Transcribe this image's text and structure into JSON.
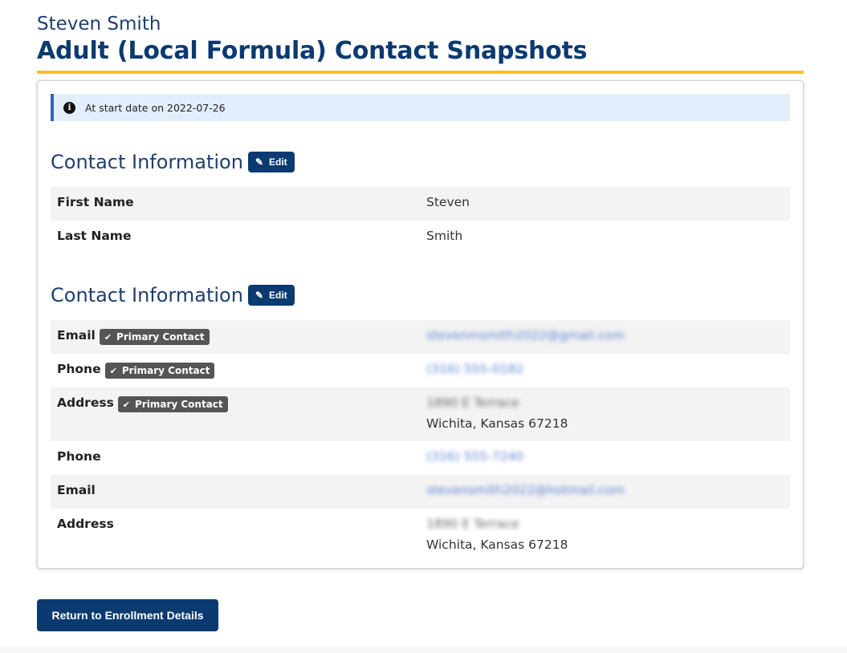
{
  "header": {
    "person_name": "Steven Smith",
    "page_title": "Adult (Local Formula) Contact Snapshots"
  },
  "alert": {
    "icon": "info-icon",
    "text": "At start date on 2022-07-26"
  },
  "sections": [
    {
      "title": "Contact Information",
      "edit_label": "Edit",
      "rows": [
        {
          "label": "First Name",
          "value": "Steven"
        },
        {
          "label": "Last Name",
          "value": "Smith"
        }
      ]
    },
    {
      "title": "Contact Information",
      "edit_label": "Edit",
      "rows": [
        {
          "label": "Email",
          "badge": "Primary Contact",
          "value": "stevenmsmith2022@gmail.com"
        },
        {
          "label": "Phone",
          "badge": "Primary Contact",
          "value": "(316) 555-0182"
        },
        {
          "label": "Address",
          "badge": "Primary Contact",
          "value_line1": "1890 E Terrace",
          "value_line2": "Wichita, Kansas 67218"
        },
        {
          "label": "Phone",
          "value": "(316) 555-7240"
        },
        {
          "label": "Email",
          "value": "stevensmith2022@hotmail.com"
        },
        {
          "label": "Address",
          "value_line1": "1890 E Terrace",
          "value_line2": "Wichita, Kansas 67218"
        }
      ]
    }
  ],
  "footer": {
    "return_label": "Return to Enrollment Details"
  },
  "colors": {
    "primary": "#0b3a70",
    "accent_underline": "#f2c418",
    "alert_bg": "#e3eefc",
    "badge_bg": "#555555"
  }
}
